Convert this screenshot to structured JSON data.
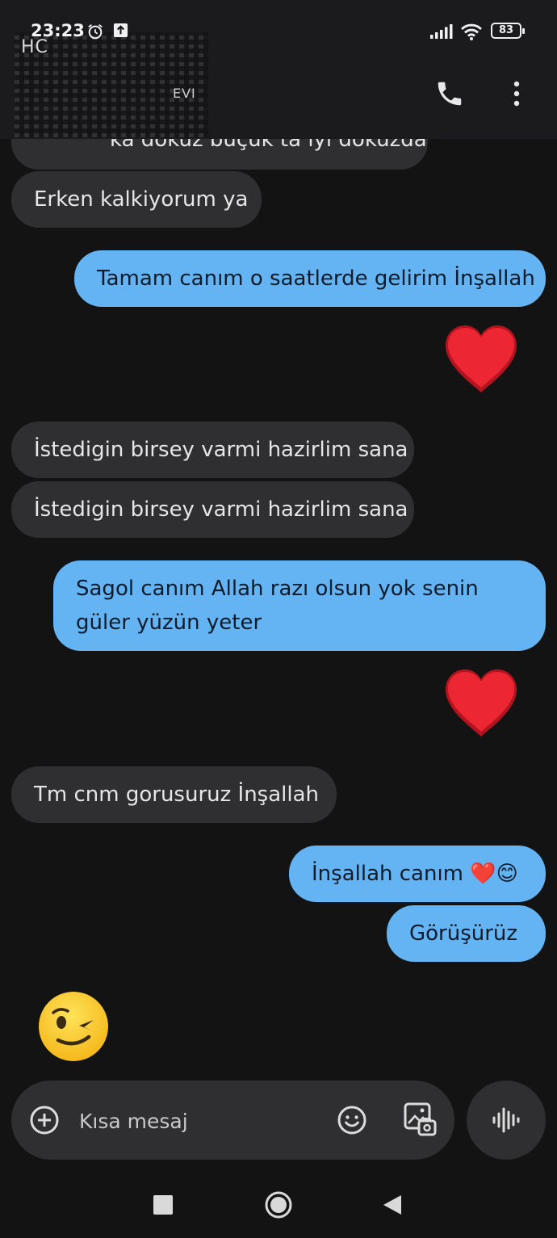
{
  "status_bar": {
    "time": "23:23",
    "battery": "83"
  },
  "header": {
    "contact_name": "HC",
    "contact_subtitle": "EVI"
  },
  "messages": {
    "partial_incoming": "ka dokuz buçuk ta iyi dokuzda",
    "m1": "Erken kalkiyorum ya",
    "m2": "Tamam canım o saatlerde gelirim İnşallah",
    "m3": "İstedigin birsey varmi hazirlim sana",
    "m4": "İstedigin birsey varmi hazirlim sana",
    "m5": "Sagol canım Allah razı olsun yok senin güler yüzün yeter",
    "m6": "Tm cnm gorusuruz İnşallah",
    "m7": "İnşallah canım ❤️😊",
    "m8": "Görüşürüz"
  },
  "compose": {
    "placeholder": "Kısa mesaj"
  },
  "colors": {
    "background": "#131314",
    "incoming_bubble": "#2f2f31",
    "outgoing_bubble": "#64b4f3",
    "heart": "#e8232f"
  },
  "icons": [
    "alarm-icon",
    "upload-icon",
    "signal-icon",
    "wifi-icon",
    "battery-icon",
    "phone-icon",
    "more-icon",
    "heart-icon",
    "wink-emoji-icon",
    "add-icon",
    "emoji-icon",
    "gallery-icon",
    "voice-icon"
  ]
}
